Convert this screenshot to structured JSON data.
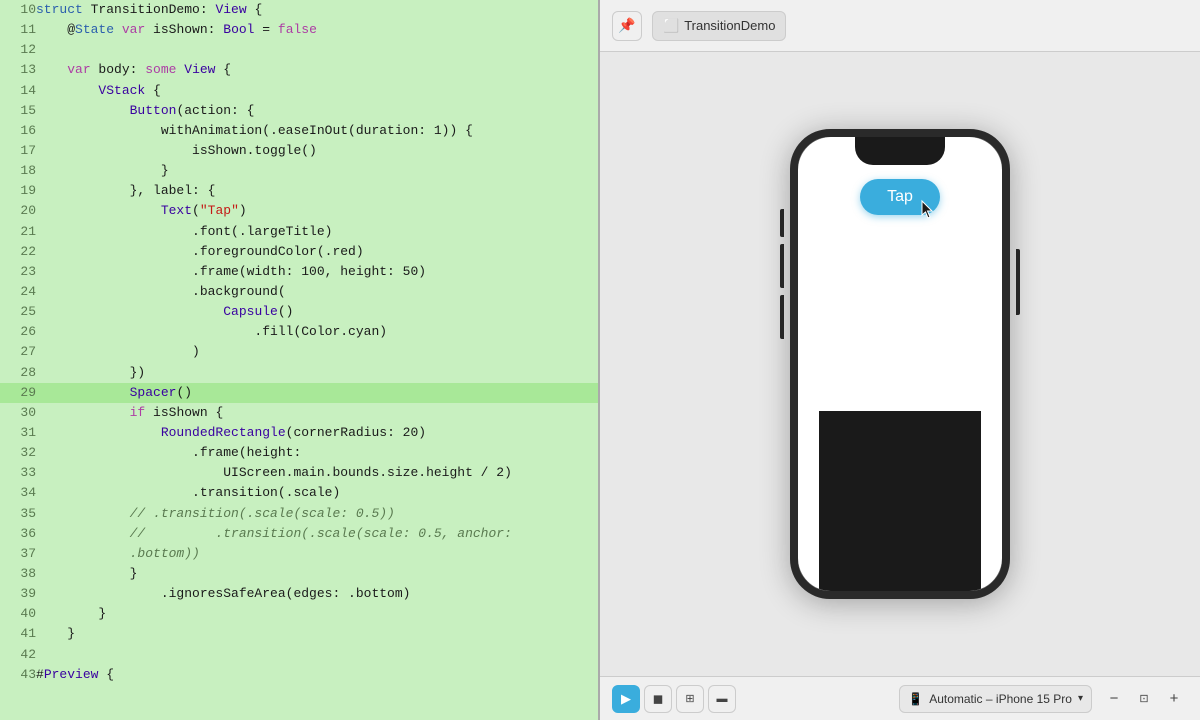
{
  "editor": {
    "lines": [
      {
        "num": 10,
        "highlighted": false,
        "tokens": [
          {
            "t": "kw2",
            "v": "struct"
          },
          {
            "t": "plain",
            "v": " TransitionDemo: "
          },
          {
            "t": "type",
            "v": "View"
          },
          {
            "t": "plain",
            "v": " {"
          }
        ]
      },
      {
        "num": 11,
        "highlighted": false,
        "tokens": [
          {
            "t": "plain",
            "v": "    @"
          },
          {
            "t": "kw2",
            "v": "State"
          },
          {
            "t": "plain",
            "v": " "
          },
          {
            "t": "kw",
            "v": "var"
          },
          {
            "t": "plain",
            "v": " isShown: "
          },
          {
            "t": "type",
            "v": "Bool"
          },
          {
            "t": "plain",
            "v": " = "
          },
          {
            "t": "kw",
            "v": "false"
          }
        ]
      },
      {
        "num": 12,
        "highlighted": false,
        "tokens": [
          {
            "t": "plain",
            "v": ""
          }
        ]
      },
      {
        "num": 13,
        "highlighted": false,
        "tokens": [
          {
            "t": "plain",
            "v": "    "
          },
          {
            "t": "kw",
            "v": "var"
          },
          {
            "t": "plain",
            "v": " body: "
          },
          {
            "t": "kw",
            "v": "some"
          },
          {
            "t": "plain",
            "v": " "
          },
          {
            "t": "type",
            "v": "View"
          },
          {
            "t": "plain",
            "v": " {"
          }
        ]
      },
      {
        "num": 14,
        "highlighted": false,
        "tokens": [
          {
            "t": "plain",
            "v": "        "
          },
          {
            "t": "type",
            "v": "VStack"
          },
          {
            "t": "plain",
            "v": " {"
          }
        ]
      },
      {
        "num": 15,
        "highlighted": false,
        "tokens": [
          {
            "t": "plain",
            "v": "            "
          },
          {
            "t": "type",
            "v": "Button"
          },
          {
            "t": "plain",
            "v": "(action: {"
          }
        ]
      },
      {
        "num": 16,
        "highlighted": false,
        "tokens": [
          {
            "t": "plain",
            "v": "                withAnimation(.easeInOut(duration: 1)) {"
          }
        ]
      },
      {
        "num": 17,
        "highlighted": false,
        "tokens": [
          {
            "t": "plain",
            "v": "                    isShown.toggle()"
          }
        ]
      },
      {
        "num": 18,
        "highlighted": false,
        "tokens": [
          {
            "t": "plain",
            "v": "                }"
          }
        ]
      },
      {
        "num": 19,
        "highlighted": false,
        "tokens": [
          {
            "t": "plain",
            "v": "            }, label: {"
          }
        ]
      },
      {
        "num": 20,
        "highlighted": false,
        "tokens": [
          {
            "t": "plain",
            "v": "                "
          },
          {
            "t": "type",
            "v": "Text"
          },
          {
            "t": "plain",
            "v": "("
          },
          {
            "t": "str",
            "v": "\"Tap\""
          },
          {
            "t": "plain",
            "v": ")"
          }
        ]
      },
      {
        "num": 21,
        "highlighted": false,
        "tokens": [
          {
            "t": "plain",
            "v": "                    .font(.largeTitle)"
          }
        ]
      },
      {
        "num": 22,
        "highlighted": false,
        "tokens": [
          {
            "t": "plain",
            "v": "                    .foregroundColor(.red)"
          }
        ]
      },
      {
        "num": 23,
        "highlighted": false,
        "tokens": [
          {
            "t": "plain",
            "v": "                    .frame(width: 100, height: 50)"
          }
        ]
      },
      {
        "num": 24,
        "highlighted": false,
        "tokens": [
          {
            "t": "plain",
            "v": "                    .background("
          }
        ]
      },
      {
        "num": 25,
        "highlighted": false,
        "tokens": [
          {
            "t": "plain",
            "v": "                        "
          },
          {
            "t": "type",
            "v": "Capsule"
          },
          {
            "t": "plain",
            "v": "()"
          }
        ]
      },
      {
        "num": 26,
        "highlighted": false,
        "tokens": [
          {
            "t": "plain",
            "v": "                            .fill(Color.cyan)"
          }
        ]
      },
      {
        "num": 27,
        "highlighted": false,
        "tokens": [
          {
            "t": "plain",
            "v": "                    )"
          }
        ]
      },
      {
        "num": 28,
        "highlighted": false,
        "tokens": [
          {
            "t": "plain",
            "v": "            })"
          }
        ]
      },
      {
        "num": 29,
        "highlighted": true,
        "tokens": [
          {
            "t": "plain",
            "v": "            "
          },
          {
            "t": "type",
            "v": "Spacer"
          },
          {
            "t": "plain",
            "v": "()"
          }
        ]
      },
      {
        "num": 30,
        "highlighted": false,
        "tokens": [
          {
            "t": "plain",
            "v": "            "
          },
          {
            "t": "kw",
            "v": "if"
          },
          {
            "t": "plain",
            "v": " isShown {"
          }
        ]
      },
      {
        "num": 31,
        "highlighted": false,
        "tokens": [
          {
            "t": "plain",
            "v": "                "
          },
          {
            "t": "type",
            "v": "RoundedRectangle"
          },
          {
            "t": "plain",
            "v": "(cornerRadius: 20)"
          }
        ]
      },
      {
        "num": 32,
        "highlighted": false,
        "tokens": [
          {
            "t": "plain",
            "v": "                    .frame(height:"
          }
        ]
      },
      {
        "num": 33,
        "highlighted": false,
        "tokens": [
          {
            "t": "plain",
            "v": "                        UIScreen.main.bounds.size.height / 2)"
          }
        ]
      },
      {
        "num": 34,
        "highlighted": false,
        "tokens": [
          {
            "t": "plain",
            "v": "                    .transition(.scale)"
          }
        ]
      },
      {
        "num": 35,
        "highlighted": false,
        "tokens": [
          {
            "t": "comment",
            "v": "            // .transition(.scale(scale: 0.5))"
          }
        ]
      },
      {
        "num": 36,
        "highlighted": false,
        "tokens": [
          {
            "t": "comment",
            "v": "            //         .transition(.scale(scale: 0.5, anchor:"
          }
        ]
      },
      {
        "num": 37,
        "highlighted": false,
        "tokens": [
          {
            "t": "comment",
            "v": "            .bottom))"
          }
        ]
      },
      {
        "num": 38,
        "highlighted": false,
        "tokens": [
          {
            "t": "plain",
            "v": "            }"
          }
        ]
      },
      {
        "num": 39,
        "highlighted": false,
        "tokens": [
          {
            "t": "plain",
            "v": "                .ignoresSafeArea(edges: .bottom)"
          }
        ]
      },
      {
        "num": 40,
        "highlighted": false,
        "tokens": [
          {
            "t": "plain",
            "v": "        }"
          }
        ]
      },
      {
        "num": 41,
        "highlighted": false,
        "tokens": [
          {
            "t": "plain",
            "v": "    }"
          }
        ]
      },
      {
        "num": 42,
        "highlighted": false,
        "tokens": [
          {
            "t": "plain",
            "v": ""
          }
        ]
      },
      {
        "num": 43,
        "highlighted": false,
        "tokens": [
          {
            "t": "plain",
            "v": "#"
          },
          {
            "t": "type",
            "v": "Preview"
          },
          {
            "t": "plain",
            "v": " {"
          }
        ]
      }
    ]
  },
  "preview": {
    "toolbar": {
      "pin_icon": "📌",
      "title": "TransitionDemo",
      "icon": "⬜"
    },
    "phone": {
      "button_label": "Tap"
    },
    "bottom": {
      "play_icon": "▶",
      "stop_icon": "◼",
      "grid_icon": "⊞",
      "layout_icon": "⬛",
      "device_icon": "📱",
      "device_label": "Automatic – iPhone 15 Pro",
      "zoom_in_icon": "+",
      "zoom_out_icon": "−",
      "zoom_fit_icon": "⊡"
    }
  }
}
